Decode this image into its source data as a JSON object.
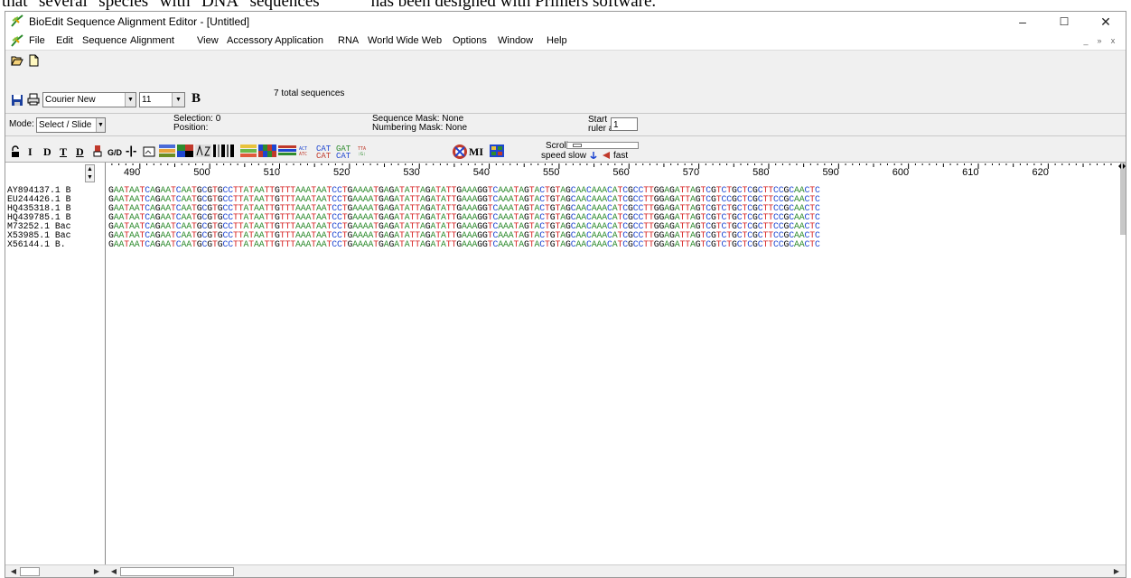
{
  "doc_strip_text": "that \"several\" species\" with \"DNA\" sequences            has been designed with Primers software.",
  "window": {
    "title": "BioEdit Sequence Alignment Editor - [Untitled]",
    "minimize": "–",
    "maximize": "☐",
    "close": "✕"
  },
  "menu": [
    "File",
    "Edit",
    "Sequence",
    "Alignment",
    "View",
    "Accessory Application",
    "RNA",
    "World Wide Web",
    "Options",
    "Window",
    "Help"
  ],
  "mdi": {
    "minimize": "_",
    "restore": "»",
    "close": "x"
  },
  "toolbar": {
    "font_name": "Courier New",
    "font_size": "11",
    "bold_label": "B",
    "total_sequences": "7 total sequences"
  },
  "mode": {
    "label": "Mode:",
    "value": "Select / Slide",
    "selection": "Selection: 0",
    "position": "Position:",
    "sequence_mask": "Sequence Mask: None",
    "numbering_mask": "Numbering Mask: None",
    "start_label1": "Start",
    "start_label2": "ruler at:",
    "start_value": "1"
  },
  "tools": {
    "bold_I": "I",
    "bold_D": "D",
    "T_under": "T",
    "D_under": "D",
    "gd": "G/D",
    "cat1": "CAT",
    "cat2": "GAT",
    "cat3": "CAT",
    "cat4": "CAT",
    "mi": "MI",
    "scroll_label": "Scroll",
    "speed_label": "speed",
    "slow": "slow",
    "fast": "fast"
  },
  "ruler": {
    "numbers": [
      "490",
      "500",
      "510",
      "520",
      "530",
      "540",
      "550",
      "560",
      "570",
      "580",
      "590",
      "600",
      "610",
      "620"
    ]
  },
  "sequences": {
    "names": [
      "AY894137.1 B",
      "EU244426.1 B",
      "HQ435318.1 B",
      "HQ439785.1 B",
      "M73252.1 Bac",
      "X53985.1 Bac",
      "X56144.1 B."
    ],
    "residues": [
      "GAATAATCAGAATCAATGCGTGCCTTATAATTGTTTAAATAATCCTGAAAATGAGATATTAGATATTGAAAGGTCAAATAGTACTGTAGCAACAAACATCGCCTTGGAGATTAGTCGTCTGCTCGCTTCCGCAACTC",
      "GAATAATCAGAATCAATGCGTGCCTTATAATTGTTTAAATAATCCTGAAAATGAGATATTAGATATTGAAAGGTCAAATAGTACTGTAGCAACAAACATCGCCTTGGAGATTAGTCGTCCGCTCGCTTCCGCAACTC",
      "GAATAATCAGAATCAATGCGTGCCTTATAATTGTTTAAATAATCCTGAAAATGAGATATTAGATATTGAAAGGTCAAATAGTACTGTAGCAACAAACATCGCCTTGGAGATTAGTCGTCTGCTCGCTTCCGCAACTC",
      "GAATAATCAGAATCAATGCGTGCCTTATAATTGTTTAAATAATCCTGAAAATGAGATATTAGATATTGAAAGGTCAAATAGTACTGTAGCAACAAACATCGCCTTGGAGATTAGTCGTCTGCTCGCTTCCGCAACTC",
      "GAATAATCAGAATCAATGCGTGCCTTATAATTGTTTAAATAATCCTGAAAATGAGATATTAGATATTGAAAGGTCAAATAGTACTGTAGCAACAAACATCGCCTTGGAGATTAGTCGTCTGCTCGCTTCCGCAACTC",
      "GAATAATCAGAATCAATGCGTGCCTTATAATTGTTTAAATAATCCTGAAAATGAGATATTAGATATTGAAAGGTCAAATAGTACTGTAGCAACAAACATCGCCTTGGAGATTAGTCGTCTGCTCGCTTCCGCAACTC",
      "GAATAATCAGAATCAATGCGTGCCTTATAATTGTTTAAATAATCCTGAAAATGAGATATTAGATATTGAAAGGTCAAATAGTACTGTAGCAACAAACATCGCCTTGGAGATTAGTCGTCTGCTCGCTTCCGCAACTC"
    ],
    "colors": {
      "A": "#2e8b2e",
      "C": "#1e46d0",
      "G": "#000000",
      "T": "#d62020"
    }
  }
}
